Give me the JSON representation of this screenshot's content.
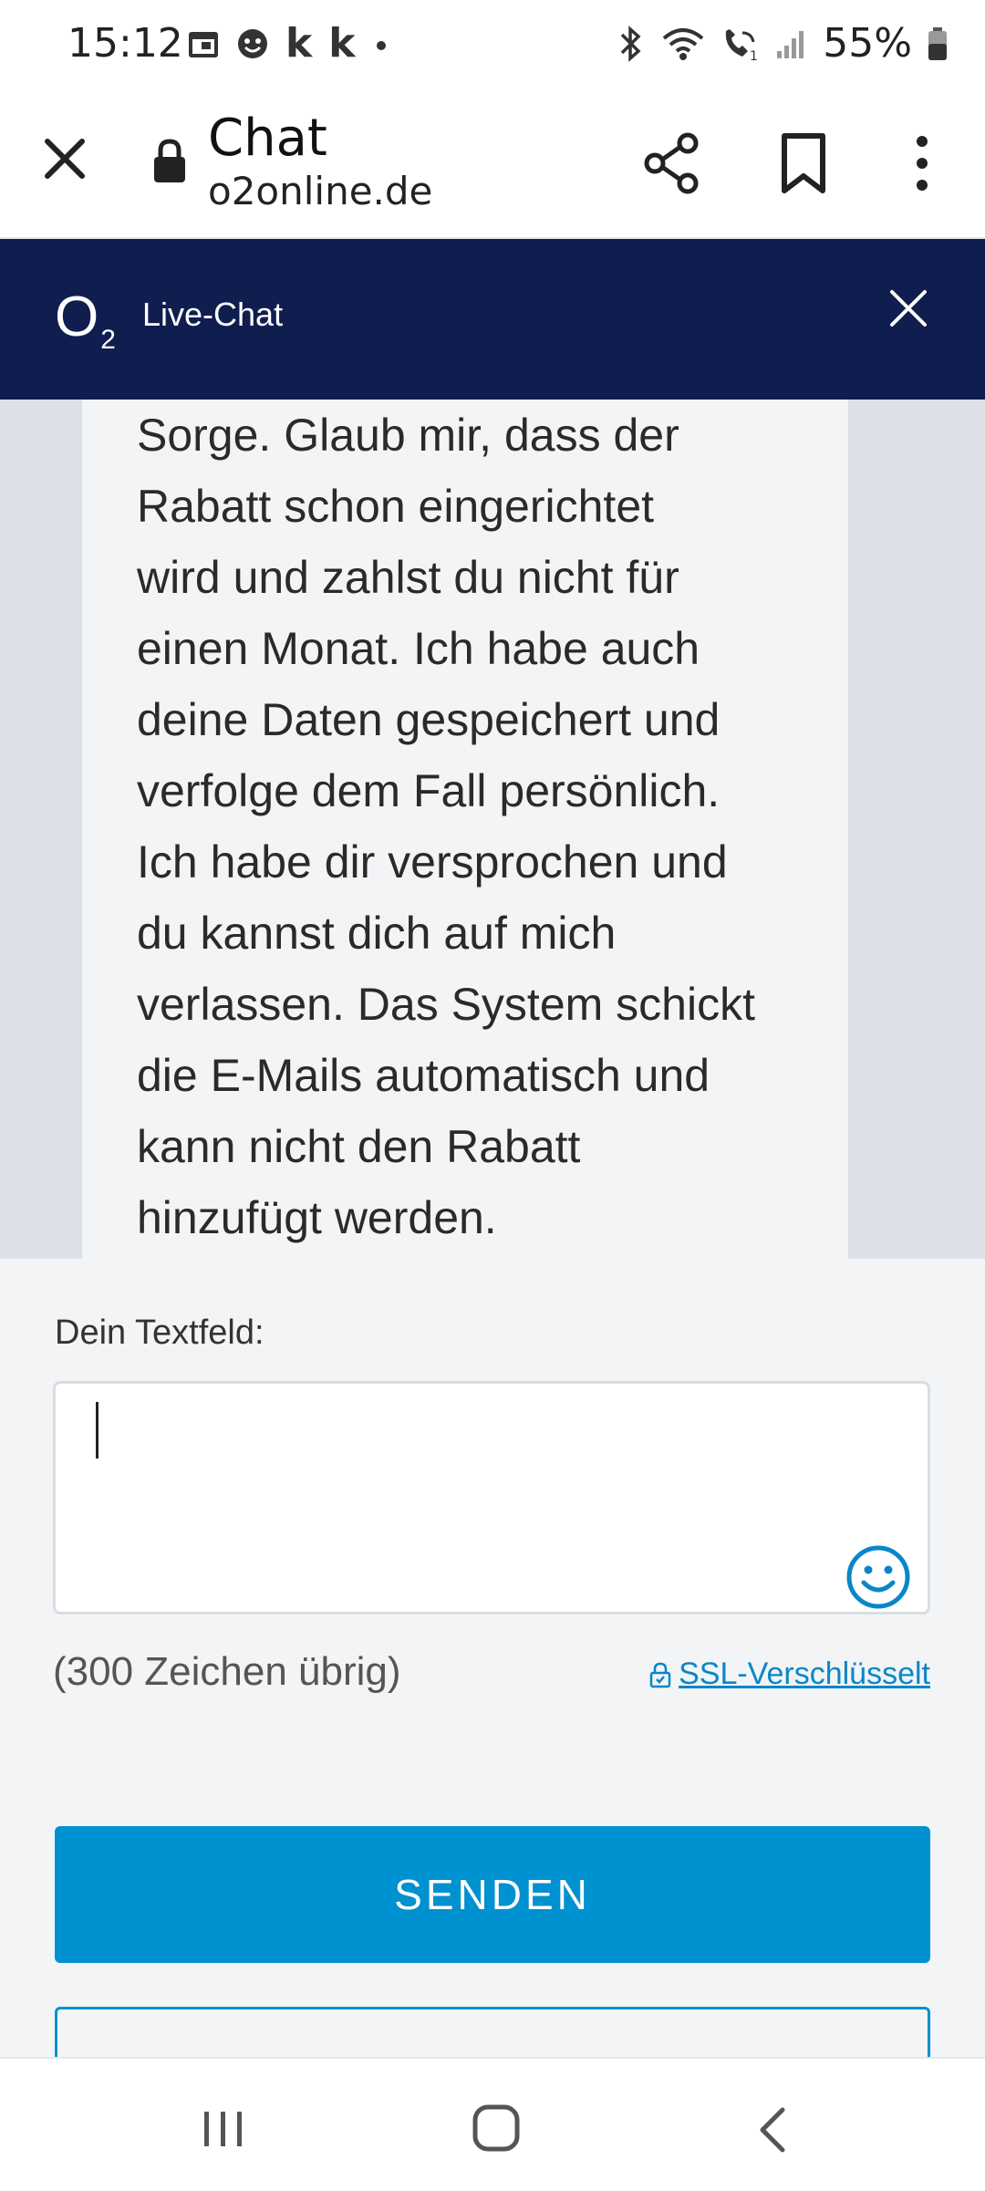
{
  "status_bar": {
    "time": "15:12",
    "battery_text": "55%",
    "left_icons": [
      "calendar-icon",
      "face-icon",
      "k-app-icon",
      "k-app-icon",
      "dot-icon"
    ],
    "right_icons": [
      "bluetooth-icon",
      "wifi-icon",
      "wifi-call-icon",
      "signal-icon",
      "battery-icon"
    ],
    "k_label": "k"
  },
  "browser": {
    "title": "Chat",
    "url": "o2online.de"
  },
  "o2_header": {
    "logo_letter": "O",
    "logo_sub": "2",
    "title": "Live-Chat"
  },
  "chat": {
    "message_lines": [
      "Sorge. Glaub mir, dass der",
      "Rabatt schon eingerichtet",
      "wird und zahlst du nicht für",
      "einen Monat. Ich habe auch",
      "deine Daten gespeichert und",
      "verfolge dem Fall persönlich.",
      "Ich habe dir versprochen und",
      "du kannst dich auf mich",
      "verlassen. Das System schickt",
      "die E-Mails automatisch und",
      "kann nicht den Rabatt",
      "hinzufügt werden."
    ]
  },
  "input": {
    "label": "Dein Textfeld:",
    "value": "",
    "counter": "(300 Zeichen übrig)",
    "ssl_label": "SSL-Verschlüsselt"
  },
  "buttons": {
    "send_label": "SENDEN"
  },
  "colors": {
    "o2_navy": "#101d4f",
    "accent_blue": "#0091d1",
    "link_blue": "#0a86c8",
    "chat_bg": "#dce1e8",
    "bubble_bg": "#f2f4f6"
  }
}
